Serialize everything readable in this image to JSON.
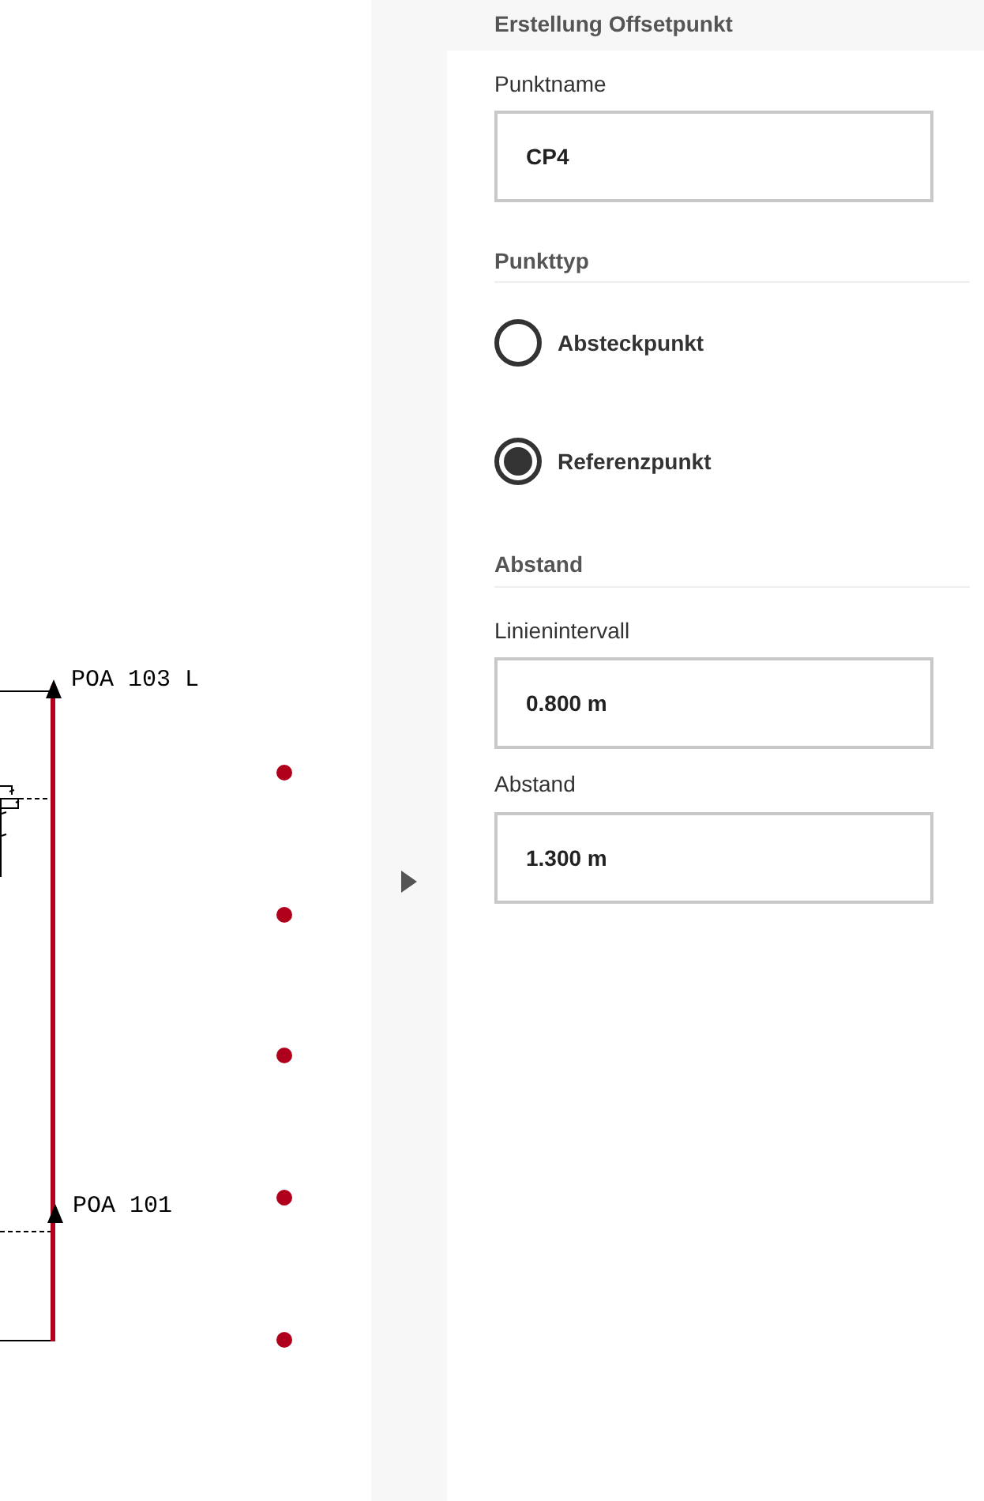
{
  "canvas": {
    "point_labels": [
      {
        "label": "POA 103 L"
      },
      {
        "label": "POA 101"
      }
    ]
  },
  "panel": {
    "title": "Erstellung Offsetpunkt",
    "point_name": {
      "label": "Punktname",
      "value": "CP4"
    },
    "point_type": {
      "heading": "Punkttyp",
      "options": [
        {
          "label": "Absteckpunkt",
          "selected": false
        },
        {
          "label": "Referenzpunkt",
          "selected": true
        }
      ]
    },
    "distance": {
      "heading": "Abstand",
      "fields": [
        {
          "label": "Linienintervall",
          "value": "0.800 m"
        },
        {
          "label": "Abstand",
          "value": "1.300 m"
        }
      ]
    }
  }
}
